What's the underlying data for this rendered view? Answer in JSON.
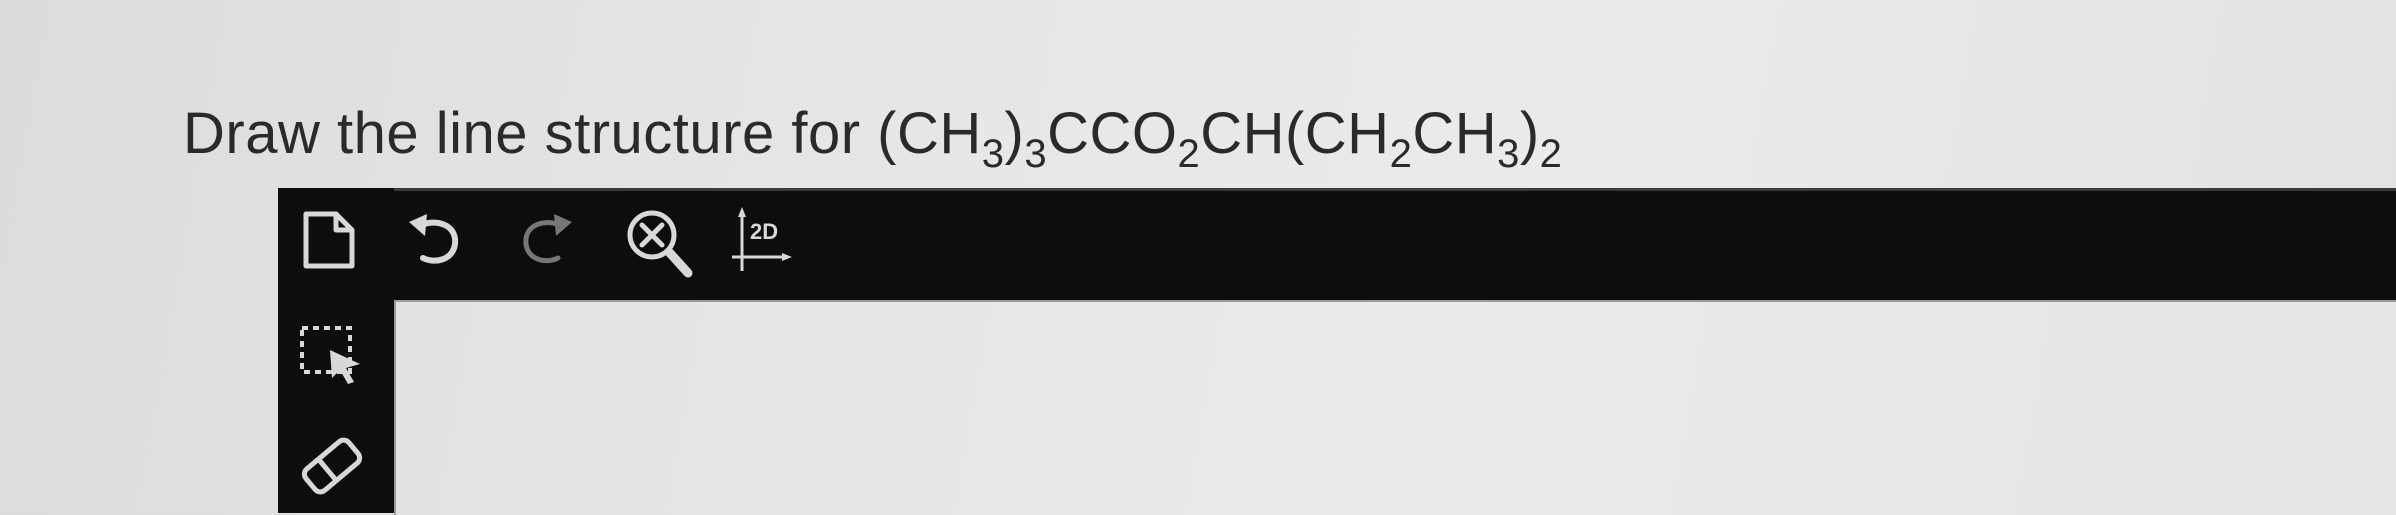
{
  "question": {
    "prefix": "Draw the line structure for ",
    "formula": [
      {
        "t": "(CH"
      },
      {
        "s": "3"
      },
      {
        "t": ")"
      },
      {
        "s": "3"
      },
      {
        "t": "CCO"
      },
      {
        "s": "2"
      },
      {
        "t": "CH(CH"
      },
      {
        "s": "2"
      },
      {
        "t": "CH"
      },
      {
        "s": "3"
      },
      {
        "t": ")"
      },
      {
        "s": "2"
      }
    ]
  },
  "toolbar": {
    "top_tools": [
      {
        "name": "new-document-icon"
      },
      {
        "name": "undo-icon"
      },
      {
        "name": "redo-icon"
      },
      {
        "name": "clear-zoom-icon"
      },
      {
        "name": "clean-2d-icon",
        "label": "2D"
      }
    ],
    "left_tools": [
      {
        "name": "select-tool-icon"
      },
      {
        "name": "eraser-icon"
      }
    ]
  },
  "colors": {
    "toolbar": "#0d0d0d",
    "icon": "#d8d8d8",
    "text": "#2a2a2a"
  }
}
